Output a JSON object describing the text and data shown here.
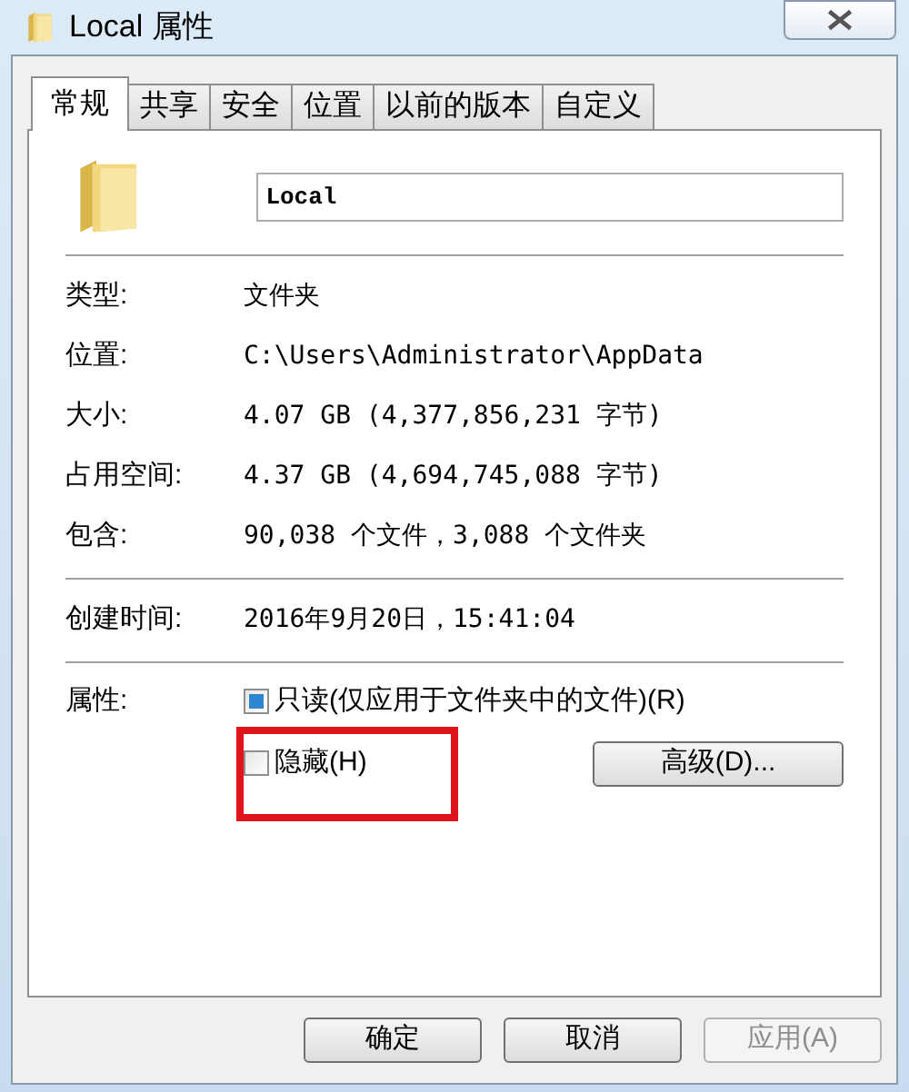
{
  "window": {
    "title": "Local 属性"
  },
  "tabs": [
    {
      "label": "常规",
      "selected": true
    },
    {
      "label": "共享",
      "selected": false
    },
    {
      "label": "安全",
      "selected": false
    },
    {
      "label": "位置",
      "selected": false
    },
    {
      "label": "以前的版本",
      "selected": false
    },
    {
      "label": "自定义",
      "selected": false
    }
  ],
  "name_field": {
    "value": "Local"
  },
  "info_groups": [
    [
      {
        "label": "类型:",
        "value": "文件夹"
      },
      {
        "label": "位置:",
        "value": "C:\\Users\\Administrator\\AppData"
      },
      {
        "label": "大小:",
        "value": "4.07 GB (4,377,856,231 字节)"
      },
      {
        "label": "占用空间:",
        "value": "4.37 GB (4,694,745,088 字节)"
      },
      {
        "label": "包含:",
        "value": "90,038 个文件，3,088 个文件夹"
      }
    ],
    [
      {
        "label": "创建时间:",
        "value": "2016年9月20日，15:41:04"
      }
    ]
  ],
  "attributes": {
    "label": "属性:",
    "options": [
      {
        "label": "只读(仅应用于文件夹中的文件)(R)",
        "checked": false,
        "mixed": true,
        "highlighted": false
      },
      {
        "label": "隐藏(H)",
        "checked": false,
        "mixed": false,
        "highlighted": true
      }
    ],
    "advanced_button": "高级(D)..."
  },
  "buttons": [
    {
      "label": "确定",
      "disabled": false
    },
    {
      "label": "取消",
      "disabled": false
    },
    {
      "label": "应用(A)",
      "disabled": true
    }
  ]
}
